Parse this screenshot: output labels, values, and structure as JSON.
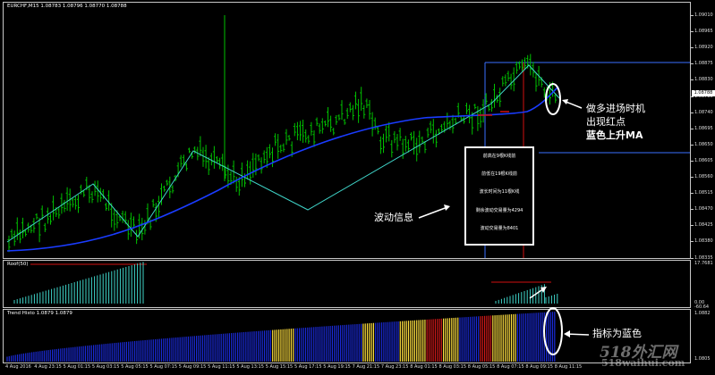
{
  "colors": {
    "background": "#000000",
    "candle": "#00c000",
    "ma": "#1a3cff",
    "zigzag": "#3fd4c8",
    "red_marker": "#d01010",
    "histo_blue": "#1a2ad8",
    "histo_yellow": "#ffe040",
    "histo_red": "#d01818",
    "hline": "#3a70ff"
  },
  "main_chart": {
    "title": "EURCHF,M15  1.08783 1.08796 1.08770 1.08788",
    "price_axis": [
      "1.09010",
      "1.08965",
      "1.08920",
      "1.08875",
      "1.08830",
      "1.08785",
      "1.08740",
      "1.08695",
      "1.08650",
      "1.08605",
      "1.08560",
      "1.08515",
      "1.08470",
      "1.08425",
      "1.08380",
      "1.08335"
    ],
    "current_price": "1.08788"
  },
  "info_box": {
    "lines": [
      "前高在9根K线前",
      "前低在19根K线前",
      "波长时间为11根K线",
      "剩余波动交易量为4294",
      "波动交易量为8401"
    ]
  },
  "annotations": {
    "wave_info": "波动信息",
    "entry_line1": "做多进场时机",
    "entry_line2": "出现红点",
    "entry_line3": "蓝色上升MA",
    "indicator_blue": "指标为蓝色"
  },
  "sub1": {
    "title": "Roof(50)",
    "scale": [
      "17.7681",
      "0.00",
      "-60.64"
    ]
  },
  "sub2": {
    "title": "Trend Histo 1.0879 1.0879",
    "scale": [
      "1.0882",
      "1.0805"
    ]
  },
  "time_axis": [
    "4 Aug 2016",
    "4 Aug 23:15",
    "5 Aug 01:15",
    "5 Aug 03:15",
    "5 Aug 05:15",
    "5 Aug 07:15",
    "5 Aug 09:15",
    "5 Aug 11:15",
    "5 Aug 13:15",
    "5 Aug 15:15",
    "5 Aug 17:15",
    "5 Aug 19:15",
    "7 Aug 21:15",
    "7 Aug 23:15",
    "8 Aug 01:15",
    "8 Aug 03:15",
    "8 Aug 05:15",
    "8 Aug 07:15",
    "8 Aug 09:15",
    "8 Aug 11:15"
  ],
  "watermark": {
    "brand": "518外汇网",
    "url": "518waihui.com"
  }
}
